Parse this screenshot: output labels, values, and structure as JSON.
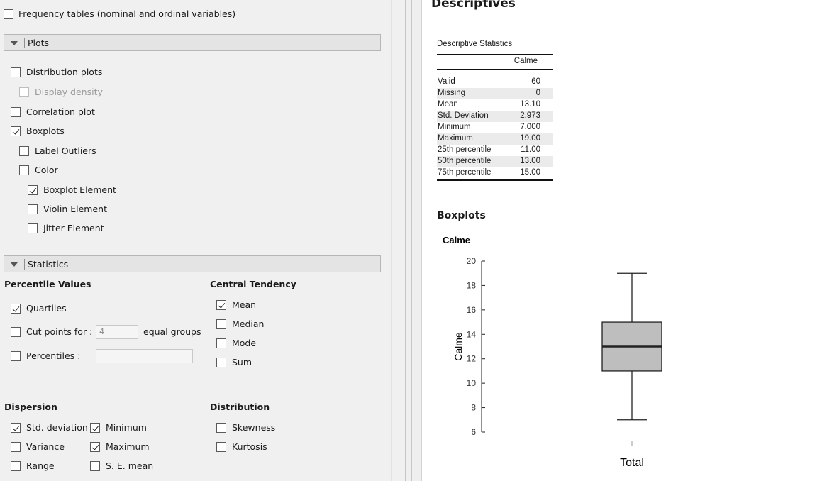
{
  "options": {
    "frequency_tables": {
      "label": "Frequency tables (nominal and ordinal variables)",
      "checked": false
    },
    "plots_section": {
      "title": "Plots",
      "distribution_plots": {
        "label": "Distribution plots",
        "checked": false
      },
      "display_density": {
        "label": "Display density",
        "checked": false,
        "disabled": true
      },
      "correlation_plot": {
        "label": "Correlation plot",
        "checked": false
      },
      "boxplots": {
        "label": "Boxplots",
        "checked": true
      },
      "label_outliers": {
        "label": "Label Outliers",
        "checked": false
      },
      "color": {
        "label": "Color",
        "checked": false
      },
      "boxplot_element": {
        "label": "Boxplot Element",
        "checked": true
      },
      "violin_element": {
        "label": "Violin Element",
        "checked": false
      },
      "jitter_element": {
        "label": "Jitter Element",
        "checked": false
      }
    },
    "statistics_section": {
      "title": "Statistics",
      "percentile_values": {
        "heading": "Percentile Values",
        "quartiles": {
          "label": "Quartiles",
          "checked": true
        },
        "cut_points": {
          "label": "Cut points for :",
          "checked": false,
          "value": "4",
          "suffix": "equal groups"
        },
        "percentiles": {
          "label": "Percentiles :",
          "checked": false,
          "value": ""
        }
      },
      "central_tendency": {
        "heading": "Central Tendency",
        "mean": {
          "label": "Mean",
          "checked": true
        },
        "median": {
          "label": "Median",
          "checked": false
        },
        "mode": {
          "label": "Mode",
          "checked": false
        },
        "sum": {
          "label": "Sum",
          "checked": false
        }
      },
      "dispersion": {
        "heading": "Dispersion",
        "std_deviation": {
          "label": "Std. deviation",
          "checked": true
        },
        "minimum": {
          "label": "Minimum",
          "checked": true
        },
        "variance": {
          "label": "Variance",
          "checked": false
        },
        "maximum": {
          "label": "Maximum",
          "checked": true
        },
        "range": {
          "label": "Range",
          "checked": false
        },
        "se_mean": {
          "label": "S. E. mean",
          "checked": false
        }
      },
      "distribution": {
        "heading": "Distribution",
        "skewness": {
          "label": "Skewness",
          "checked": false
        },
        "kurtosis": {
          "label": "Kurtosis",
          "checked": false
        }
      }
    }
  },
  "results": {
    "title": "Descriptives",
    "table": {
      "caption": "Descriptive Statistics",
      "column": "Calme",
      "rows": [
        {
          "label": "Valid",
          "value": "60"
        },
        {
          "label": "Missing",
          "value": "0"
        },
        {
          "label": "Mean",
          "value": "13.10"
        },
        {
          "label": "Std. Deviation",
          "value": "2.973"
        },
        {
          "label": "Minimum",
          "value": "7.000"
        },
        {
          "label": "Maximum",
          "value": "19.00"
        },
        {
          "label": "25th percentile",
          "value": "11.00"
        },
        {
          "label": "50th percentile",
          "value": "13.00"
        },
        {
          "label": "75th percentile",
          "value": "15.00"
        }
      ]
    },
    "boxplots_title": "Boxplots",
    "plot_title": "Calme"
  },
  "chart_data": {
    "type": "boxplot",
    "title": "Calme",
    "ylabel": "Calme",
    "xlabel": "",
    "categories": [
      "Total"
    ],
    "ylim": [
      6,
      20
    ],
    "yticks": [
      6,
      8,
      10,
      12,
      14,
      16,
      18,
      20
    ],
    "boxes": [
      {
        "category": "Total",
        "min": 7,
        "q1": 11,
        "median": 13,
        "q3": 15,
        "max": 19
      }
    ],
    "colors": {
      "box_fill": "#bebebe",
      "stroke": "#222222"
    }
  }
}
